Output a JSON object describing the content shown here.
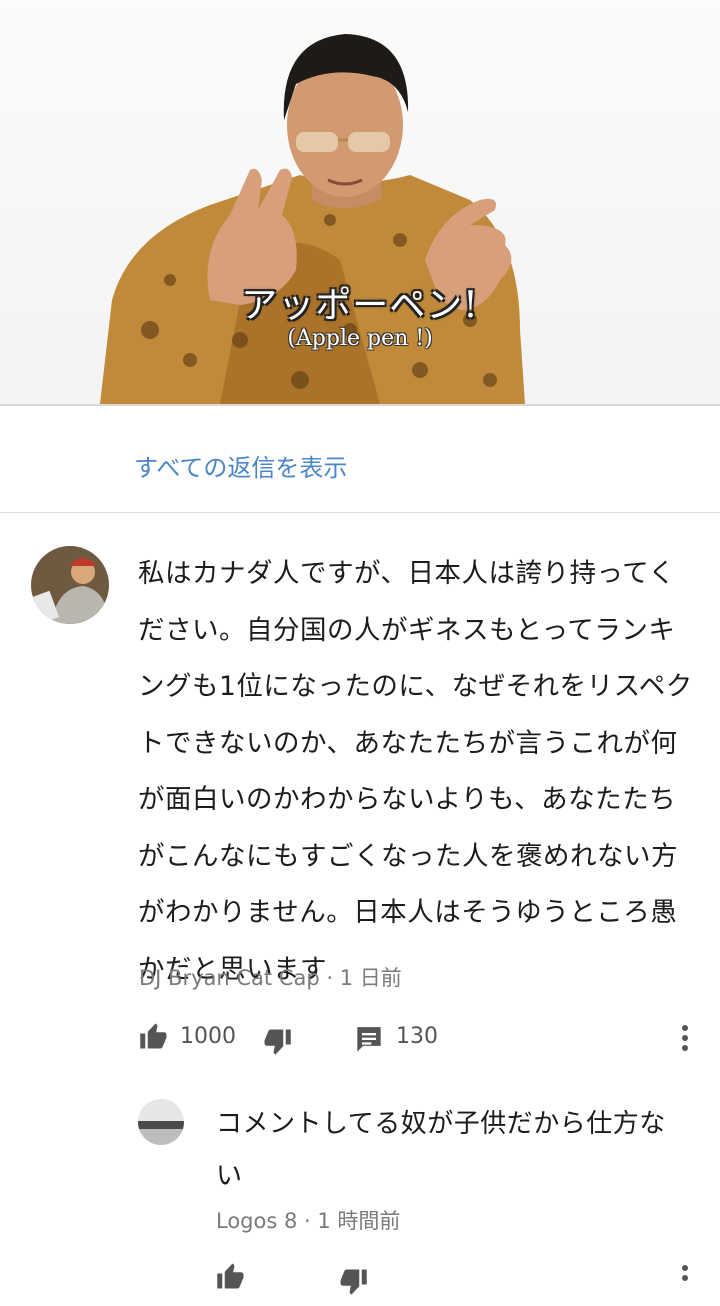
{
  "video": {
    "caption_jp": "アッポーペン!",
    "caption_en": "(Apple pen !)"
  },
  "replies_link": "すべての返信を表示",
  "comment": {
    "text": "私はカナダ人ですが、日本人は誇り持ってください。自分国の人がギネスもとってランキングも1位になったのに、なぜそれをリスペクトできないのか、あなたたちが言うこれが何が面白いのかわからないよりも、あなたたちがこんなにもすごくなった人を褒めれない方がわかりません。日本人はそうゆうところ愚かだと思います",
    "author": "DJ Bryan Cat Cap",
    "time": "· 1 日前",
    "likes": "1000",
    "replies": "130"
  },
  "reply": {
    "text": "コメントしてる奴が子供だから仕方ない",
    "author": "Logos 8",
    "time": "· 1 時間前"
  }
}
